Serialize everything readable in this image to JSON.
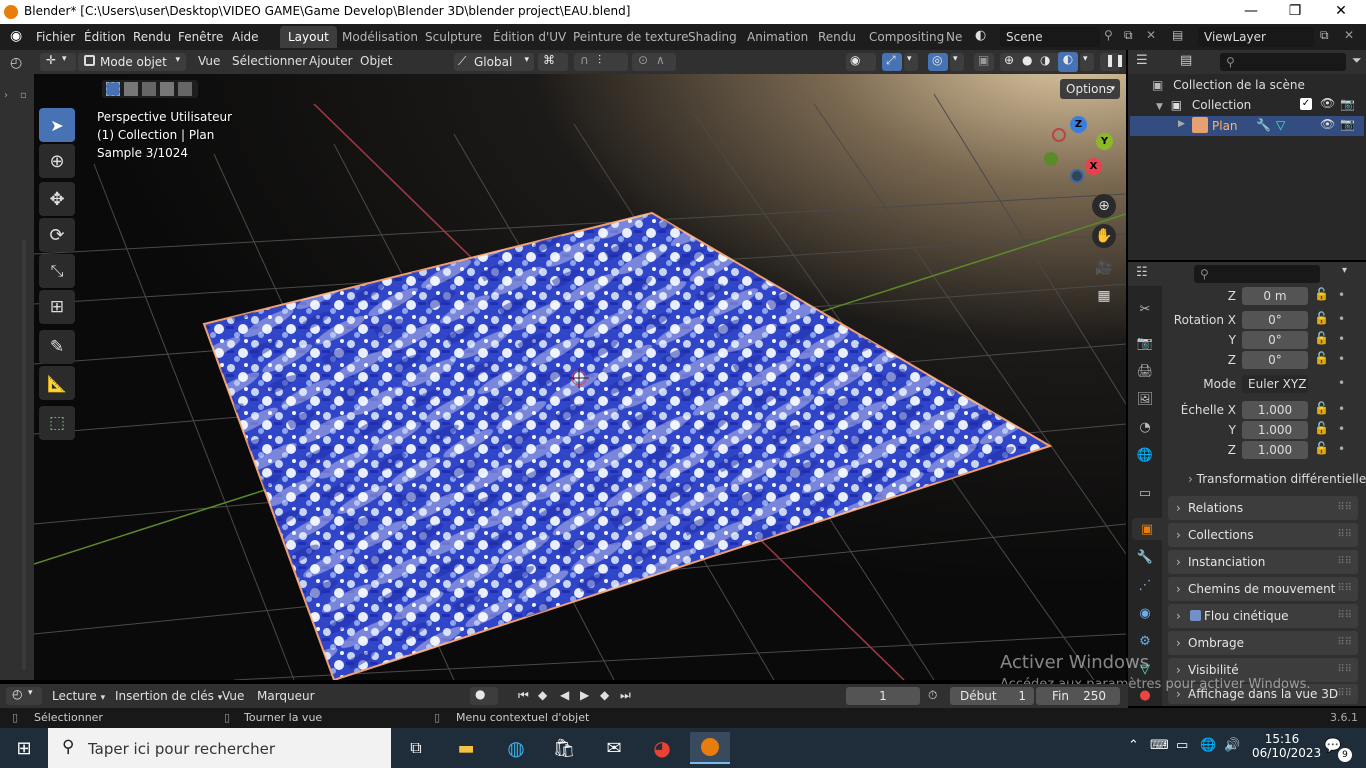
{
  "window": {
    "title": "Blender* [C:\\Users\\user\\Desktop\\VIDEO GAME\\Game Develop\\Blender 3D\\blender project\\EAU.blend]"
  },
  "menu": {
    "items": [
      "Fichier",
      "Édition",
      "Rendu",
      "Fenêtre",
      "Aide"
    ]
  },
  "workspaces": {
    "tabs": [
      "Layout",
      "Modélisation",
      "Sculpture",
      "Édition d'UV",
      "Peinture de texture",
      "Shading",
      "Animation",
      "Rendu",
      "Compositing",
      "Ne"
    ],
    "active": "Layout"
  },
  "scene": {
    "name": "Scene"
  },
  "viewlayer": {
    "name": "ViewLayer"
  },
  "header3d": {
    "mode": "Mode objet",
    "vue": "Vue",
    "selectionner": "Sélectionner",
    "ajouter": "Ajouter",
    "objet": "Objet",
    "orientation": "Global",
    "options": "Options"
  },
  "viewport": {
    "line1": "Perspective Utilisateur",
    "line2": "(1) Collection | Plan",
    "line3": "Sample 3/1024"
  },
  "gizmo": {
    "x": "X",
    "y": "Y",
    "z": "Z"
  },
  "outliner": {
    "root": "Collection de la scène",
    "collection": "Collection",
    "object": "Plan"
  },
  "properties": {
    "rows": [
      {
        "label": "Z",
        "value": "0 m"
      },
      {
        "label": "Rotation X",
        "value": "0°"
      },
      {
        "label": "Y",
        "value": "0°"
      },
      {
        "label": "Z",
        "value": "0°"
      },
      {
        "label": "Mode",
        "value": "Euler XYZ"
      },
      {
        "label": "Échelle X",
        "value": "1.000"
      },
      {
        "label": "Y",
        "value": "1.000"
      },
      {
        "label": "Z",
        "value": "1.000"
      }
    ],
    "delta": "Transformation différentielle",
    "panels": [
      "Relations",
      "Collections",
      "Instanciation",
      "Chemins de mouvement",
      "Flou cinétique",
      "Ombrage",
      "Visibilité",
      "Affichage dans la vue 3D"
    ]
  },
  "timeline": {
    "lecture": "Lecture",
    "insertion": "Insertion de clés",
    "vue": "Vue",
    "marqueur": "Marqueur",
    "current_frame": "1",
    "debut_label": "Début",
    "debut": "1",
    "fin_label": "Fin",
    "fin": "250"
  },
  "statusbar": {
    "select": "Sélectionner",
    "rotate": "Tourner la vue",
    "context": "Menu contextuel d'objet",
    "version": "3.6.1"
  },
  "watermark": {
    "line1": "Activer Windows",
    "line2": "Accédez aux paramètres pour activer Windows."
  },
  "taskbar": {
    "search_placeholder": "Taper ici pour rechercher",
    "time": "15:16",
    "date": "06/10/2023",
    "notifications": "9"
  },
  "colors": {
    "accent": "#4772b3",
    "blender_orange": "#e87d0d",
    "x_axis": "#e8414f",
    "y_axis": "#8bb82a",
    "z_axis": "#3b7fde"
  }
}
